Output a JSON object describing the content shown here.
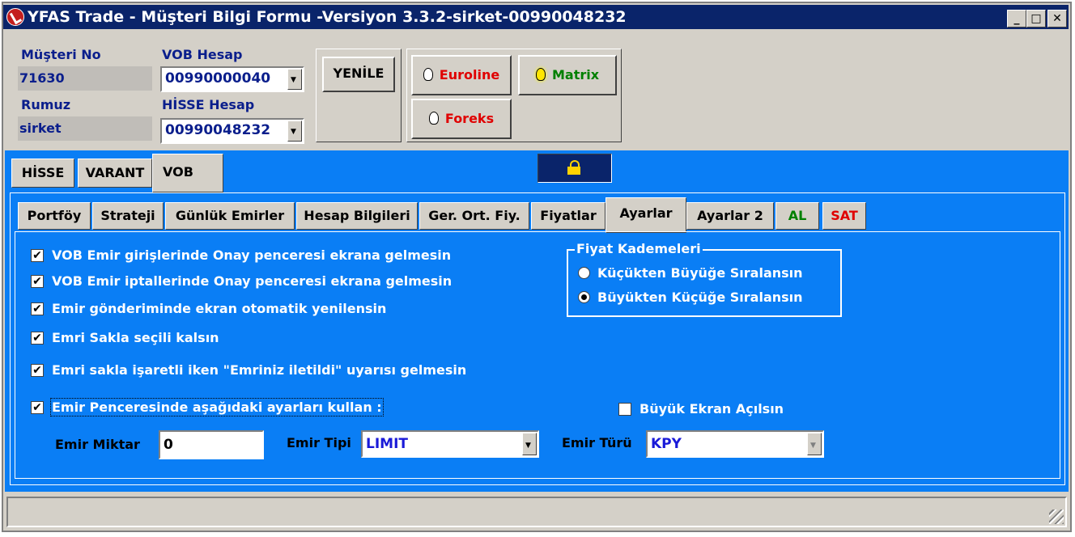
{
  "window": {
    "title": "YFAS Trade - Müşteri Bilgi Formu -Versiyon 3.3.2-sirket-00990048232",
    "minimize": "_",
    "maximize": "□",
    "close": "✕"
  },
  "account": {
    "customer_no_label": "Müşteri No",
    "customer_no": "71630",
    "nickname_label": "Rumuz",
    "nickname": "sirket",
    "vob_account_label": "VOB Hesap",
    "vob_account": "00990000040",
    "stock_account_label": "HİSSE Hesap",
    "stock_account": "00990048232"
  },
  "buttons": {
    "refresh": "YENİLE",
    "euroline": "Euroline",
    "matrix": "Matrix",
    "foreks": "Foreks"
  },
  "colors": {
    "euroline": "#e00000",
    "matrix": "#008000",
    "foreks": "#e00000",
    "panel": "#0a7ef5"
  },
  "main_tabs": [
    "HİSSE",
    "VARANT",
    "VOB"
  ],
  "sub_tabs": [
    "Portföy",
    "Strateji",
    "Günlük Emirler",
    "Hesap Bilgileri",
    "Ger. Ort. Fiy.",
    "Fiyatlar",
    "Ayarlar",
    "Ayarlar 2",
    "AL",
    "SAT"
  ],
  "settings": {
    "checks": [
      "VOB Emir girişlerinde Onay penceresi ekrana gelmesin",
      "VOB Emir iptallerinde Onay penceresi ekrana gelmesin",
      "Emir gönderiminde ekran otomatik yenilensin",
      "Emri Sakla seçili kalsın",
      "Emri sakla işaretli iken \"Emriniz iletildi\" uyarısı gelmesin",
      "Emir Penceresinde aşağıdaki ayarları kullan :"
    ],
    "price_levels_title": "Fiyat Kademeleri",
    "price_levels": [
      "Küçükten Büyüğe Sıralansın",
      "Büyükten Küçüğe Sıralansın"
    ],
    "selected_price_level": "Büyükten Küçüğe Sıralansın",
    "big_screen": "Büyük Ekran Açılsın",
    "qty_label": "Emir Miktar",
    "qty_value": "0",
    "type_label": "Emir Tipi",
    "type_value": "LIMIT",
    "kind_label": "Emir Türü",
    "kind_value": "KPY"
  }
}
